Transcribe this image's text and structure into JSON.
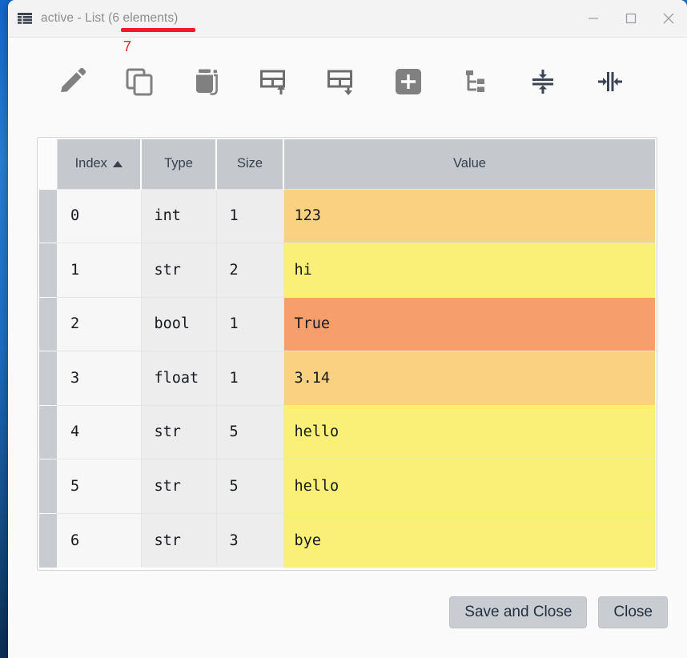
{
  "window": {
    "title": "active - List (6 elements)",
    "icon": "table-grid-icon",
    "controls": {
      "minimize": "minimize-icon",
      "maximize": "maximize-icon",
      "close": "close-icon"
    }
  },
  "annotation": {
    "number": "7",
    "color": "#ee1c25",
    "target": "(6 elements)"
  },
  "toolbar": {
    "items": [
      {
        "name": "edit-icon",
        "tip": "Edit"
      },
      {
        "name": "copy-icon",
        "tip": "Copy"
      },
      {
        "name": "delete-icon",
        "tip": "Delete"
      },
      {
        "name": "insert-row-above-icon",
        "tip": "Insert row above"
      },
      {
        "name": "insert-row-below-icon",
        "tip": "Insert row below"
      },
      {
        "name": "add-icon",
        "tip": "Add"
      },
      {
        "name": "tree-view-icon",
        "tip": "Tree view"
      },
      {
        "name": "fit-rows-icon",
        "tip": "Fit rows"
      },
      {
        "name": "fit-columns-icon",
        "tip": "Fit columns"
      }
    ]
  },
  "table": {
    "columns": [
      {
        "key": "index",
        "label": "Index",
        "sorted": "asc"
      },
      {
        "key": "type",
        "label": "Type",
        "sorted": ""
      },
      {
        "key": "size",
        "label": "Size",
        "sorted": ""
      },
      {
        "key": "value",
        "label": "Value",
        "sorted": ""
      }
    ],
    "rows": [
      {
        "index": "0",
        "type": "int",
        "size": "1",
        "value": "123",
        "value_color": "#fad181"
      },
      {
        "index": "1",
        "type": "str",
        "size": "2",
        "value": "hi",
        "value_color": "#faf077"
      },
      {
        "index": "2",
        "type": "bool",
        "size": "1",
        "value": "True",
        "value_color": "#f79f6c"
      },
      {
        "index": "3",
        "type": "float",
        "size": "1",
        "value": "3.14",
        "value_color": "#fad181"
      },
      {
        "index": "4",
        "type": "str",
        "size": "5",
        "value": "hello",
        "value_color": "#faf077"
      },
      {
        "index": "5",
        "type": "str",
        "size": "5",
        "value": "hello",
        "value_color": "#faf077"
      },
      {
        "index": "6",
        "type": "str",
        "size": "3",
        "value": "bye",
        "value_color": "#faf077"
      }
    ]
  },
  "footer": {
    "save_and_close_label": "Save and Close",
    "close_label": "Close"
  },
  "colors": {
    "header_bg": "#c5c9cd",
    "handle_bg": "#c8ccd0",
    "button_bg": "#c9cdd1",
    "annotation": "#ee1c25",
    "icon_grey": "#808080",
    "icon_navy": "#3a4454"
  }
}
